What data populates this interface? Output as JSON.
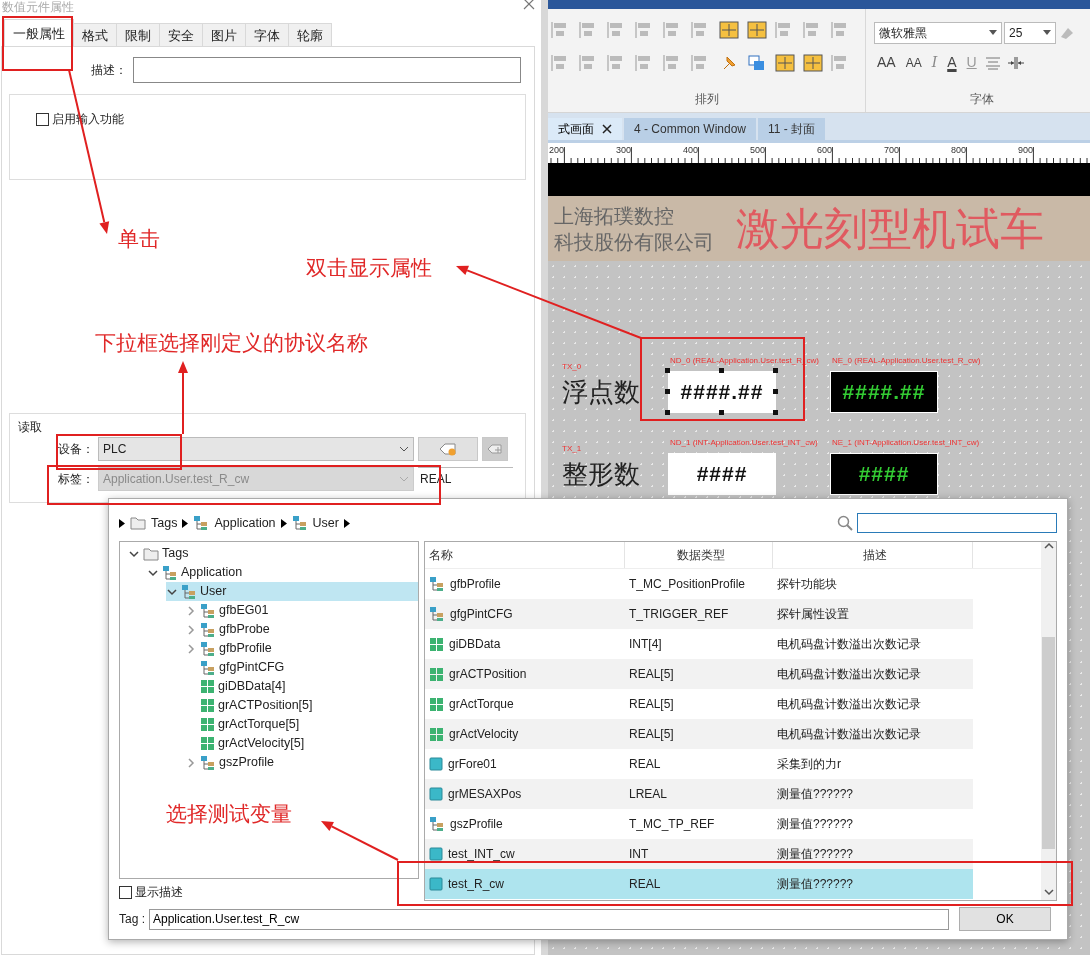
{
  "dialog": {
    "title": "数值元件属性",
    "tabs": [
      {
        "label": "一般属性",
        "selected": true
      },
      {
        "label": "格式",
        "selected": false
      },
      {
        "label": "限制",
        "selected": false
      },
      {
        "label": "安全",
        "selected": false
      },
      {
        "label": "图片",
        "selected": false
      },
      {
        "label": "字体",
        "selected": false
      },
      {
        "label": "轮廓",
        "selected": false
      }
    ],
    "description_label": "描述：",
    "input_enable": {
      "label": "启用输入功能",
      "checked": false
    },
    "read_group": {
      "title": "读取",
      "device": {
        "label": "设备：",
        "value": "PLC"
      },
      "tag": {
        "label": "标签：",
        "value": "Application.User.test_R_cw",
        "disabled": true
      },
      "data_type": "REAL"
    }
  },
  "app": {
    "ribbon": {
      "arrange_label": "排列",
      "font_label": "字体",
      "font": "微软雅黑",
      "font_size": "25",
      "glyph_buttons": [
        {
          "kind": "grow",
          "glyph": "AA"
        },
        {
          "kind": "shrink",
          "glyph": "AA"
        },
        {
          "kind": "italic",
          "glyph": "I"
        },
        {
          "kind": "color",
          "glyph": "A"
        },
        {
          "kind": "underline",
          "glyph": "U"
        }
      ]
    },
    "doc_tabs": [
      {
        "label": "式画面",
        "selected": true,
        "closable": true
      },
      {
        "label": "4 - Common Window",
        "selected": false,
        "closable": false
      },
      {
        "label": "11 - 封面",
        "selected": false,
        "closable": false
      }
    ],
    "ruler": [
      "200",
      "300",
      "400",
      "500",
      "600",
      "700",
      "800",
      "900"
    ],
    "screen": {
      "company": [
        "上海拓璞数控",
        "科技股份有限公司"
      ],
      "title": "激光刻型机试车",
      "rows": [
        {
          "tag_id": "TX_0",
          "label": "浮点数",
          "displays": [
            {
              "kind": "input",
              "caption": "ND_0 (REAL-Application.User.test_R_cw)",
              "value": "####.##",
              "selected": true
            },
            {
              "kind": "display",
              "caption": "NE_0 (REAL-Application.User.test_R_cw)",
              "value": "####.##",
              "selected": false
            }
          ]
        },
        {
          "tag_id": "TX_1",
          "label": "整形数",
          "displays": [
            {
              "kind": "input",
              "caption": "ND_1 (INT-Application.User.test_INT_cw)",
              "value": "####",
              "selected": false
            },
            {
              "kind": "display",
              "caption": "NE_1 (INT-Application.User.test_INT_cw)",
              "value": "####",
              "selected": false
            }
          ]
        }
      ]
    }
  },
  "tag_browser": {
    "breadcrumb": [
      {
        "label": "Tags",
        "kind": "folder"
      },
      {
        "label": "Application",
        "kind": "struct"
      },
      {
        "label": "User",
        "kind": "struct"
      }
    ],
    "tree": [
      {
        "label": "Tags",
        "kind": "folder",
        "expandable": true,
        "expanded": true,
        "selected": false,
        "children": [
          {
            "label": "Application",
            "kind": "struct",
            "expandable": true,
            "expanded": true,
            "selected": false,
            "children": [
              {
                "label": "User",
                "kind": "struct",
                "expandable": true,
                "expanded": true,
                "selected": true,
                "children": [
                  {
                    "label": "gfbEG01",
                    "kind": "struct",
                    "expandable": true,
                    "expanded": false,
                    "selected": false
                  },
                  {
                    "label": "gfbProbe",
                    "kind": "struct",
                    "expandable": true,
                    "expanded": false,
                    "selected": false
                  },
                  {
                    "label": "gfbProfile",
                    "kind": "struct",
                    "expandable": true,
                    "expanded": false,
                    "selected": false
                  },
                  {
                    "label": "gfgPintCFG",
                    "kind": "struct",
                    "expandable": false,
                    "selected": false
                  },
                  {
                    "label": "giDBData[4]",
                    "kind": "array",
                    "expandable": false,
                    "selected": false
                  },
                  {
                    "label": "grACTPosition[5]",
                    "kind": "array",
                    "expandable": false,
                    "selected": false
                  },
                  {
                    "label": "grActTorque[5]",
                    "kind": "array",
                    "expandable": false,
                    "selected": false
                  },
                  {
                    "label": "grActVelocity[5]",
                    "kind": "array",
                    "expandable": false,
                    "selected": false
                  },
                  {
                    "label": "gszProfile",
                    "kind": "struct",
                    "expandable": true,
                    "expanded": false,
                    "selected": false
                  }
                ]
              }
            ]
          }
        ]
      }
    ],
    "columns": [
      "名称",
      "数据类型",
      "描述"
    ],
    "rows": [
      {
        "kind": "struct",
        "name": "gfbProfile",
        "type": "T_MC_PositionProfile",
        "description": "探针功能块",
        "selected": false
      },
      {
        "kind": "struct",
        "name": "gfgPintCFG",
        "type": "T_TRIGGER_REF",
        "description": "探针属性设置",
        "selected": false
      },
      {
        "kind": "array",
        "name": "giDBData",
        "type": "INT[4]",
        "description": "电机码盘计数溢出次数记录",
        "selected": false
      },
      {
        "kind": "array",
        "name": "grACTPosition",
        "type": "REAL[5]",
        "description": "电机码盘计数溢出次数记录",
        "selected": false
      },
      {
        "kind": "array",
        "name": "grActTorque",
        "type": "REAL[5]",
        "description": "电机码盘计数溢出次数记录",
        "selected": false
      },
      {
        "kind": "array",
        "name": "grActVelocity",
        "type": "REAL[5]",
        "description": "电机码盘计数溢出次数记录",
        "selected": false
      },
      {
        "kind": "scalar",
        "name": "grFore01",
        "type": "REAL",
        "description": "采集到的力r",
        "selected": false
      },
      {
        "kind": "scalar",
        "name": "grMESAXPos",
        "type": "LREAL",
        "description": "测量值??????",
        "selected": false
      },
      {
        "kind": "struct",
        "name": "gszProfile",
        "type": "T_MC_TP_REF",
        "description": "测量值??????",
        "selected": false
      },
      {
        "kind": "scalar",
        "name": "test_INT_cw",
        "type": "INT",
        "description": "测量值??????",
        "selected": false
      },
      {
        "kind": "scalar",
        "name": "test_R_cw",
        "type": "REAL",
        "description": "测量值??????",
        "selected": true
      }
    ],
    "show_description": {
      "label": "显示描述",
      "checked": false
    },
    "tag": {
      "label": "Tag :",
      "value": "Application.User.test_R_cw"
    },
    "ok_button": "OK"
  },
  "annotations": [
    {
      "text": "单击"
    },
    {
      "text": "双击显示属性"
    },
    {
      "text": "下拉框选择刚定义的协议名称"
    },
    {
      "text": "选择测试变量"
    }
  ]
}
